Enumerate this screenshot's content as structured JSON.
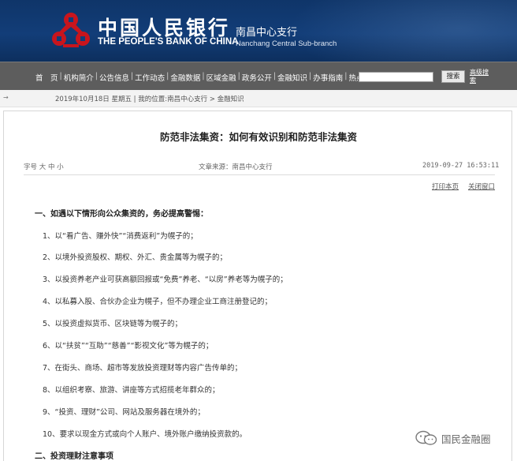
{
  "header": {
    "bank_name_cn": "中国人民银行",
    "bank_name_en": "THE PEOPLE'S BANK OF CHINA",
    "branch_cn": "南昌中心支行",
    "branch_en": "Nanchang Central Sub-branch",
    "brand_color": "#123d78",
    "logo_color": "#c8151d"
  },
  "nav": {
    "items": [
      "首　页",
      "机构简介",
      "公告信息",
      "工作动态",
      "金融数据",
      "区域金融",
      "政务公开",
      "金融知识",
      "办事指南",
      "热点专题"
    ],
    "search_placeholder": "",
    "search_button": "搜索",
    "advanced_search": "高级搜索"
  },
  "breadcrumb": {
    "arrow": "→",
    "date": "2019年10月18日 星期五",
    "sep": "|",
    "location_label": "我的位置:",
    "location_path": "南昌中心支行 > 金融知识"
  },
  "article": {
    "title": "防范非法集资：如何有效识别和防范非法集资",
    "font_size_label": "字号",
    "font_size_options": [
      "大",
      "中",
      "小"
    ],
    "source": "文章来源：南昌中心支行",
    "datetime": "2019-09-27  16:53:11",
    "print_label": "打印本页",
    "close_label": "关闭窗口",
    "section1_heading": "一、如遇以下情形向公众集资的，务必提高警惕：",
    "items": [
      "1、以“看广告、赚外快”“消费返利”为幌子的；",
      "2、以境外投资股权、期权、外汇、贵金属等为幌子的；",
      "3、以投资养老产业可获高额回报或“免费”养老、“以房”养老等为幌子的；",
      "4、以私募入股、合伙办企业为幌子，但不办理企业工商注册登记的；",
      "5、以投资虚拟货币、区块链等为幌子的；",
      "6、以“扶贫”“互助”“慈善”“影视文化”等为幌子的；",
      "7、在街头、商场、超市等发放投资理财等内容广告传单的；",
      "8、以组织考察、旅游、讲座等方式招揽老年群众的；",
      "9、“投资、理财”公司、网站及服务器在境外的；",
      "10、要求以现金方式或向个人账户、境外账户缴纳投资款的。"
    ],
    "section2_heading": "二、投资理财注意事项"
  },
  "watermark": {
    "text": "国民金融圈",
    "icon": "wechat-icon"
  }
}
